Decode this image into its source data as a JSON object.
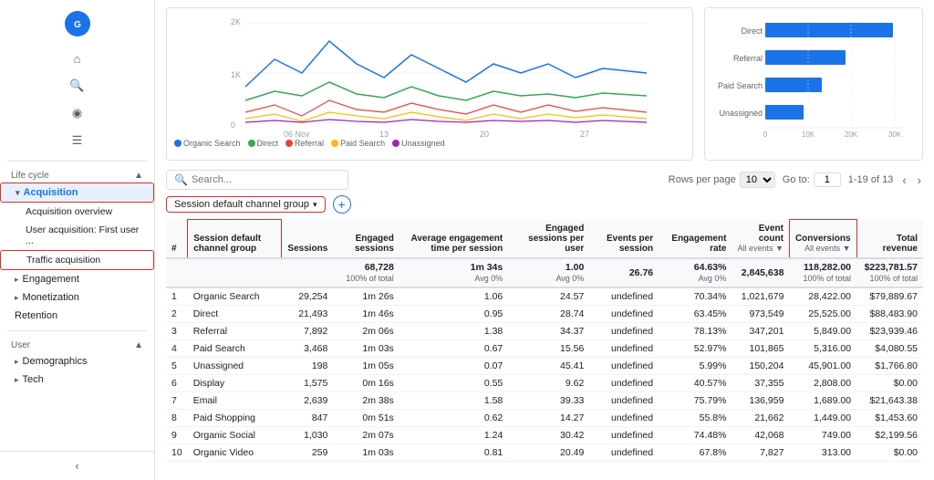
{
  "sidebar": {
    "logo": "G",
    "sections": [
      {
        "label": "Life cycle",
        "chevron": "▲",
        "items": [
          {
            "label": "Acquisition",
            "level": 1,
            "active": true,
            "highlight": true,
            "expandable": true
          },
          {
            "label": "Acquisition overview",
            "level": 2
          },
          {
            "label": "User acquisition: First user ...",
            "level": 2
          },
          {
            "label": "Traffic acquisition",
            "level": 2,
            "highlight": true
          },
          {
            "label": "Engagement",
            "level": 1,
            "expandable": true
          },
          {
            "label": "Monetization",
            "level": 1,
            "expandable": true
          },
          {
            "label": "Retention",
            "level": 1
          }
        ]
      },
      {
        "label": "User",
        "chevron": "▲",
        "items": [
          {
            "label": "Demographics",
            "level": 1,
            "expandable": true
          },
          {
            "label": "Tech",
            "level": 1,
            "expandable": true
          }
        ]
      }
    ]
  },
  "toolbar": {
    "search_placeholder": "Search...",
    "rows_per_page_label": "Rows per page",
    "rows_per_page_value": "10",
    "goto_label": "Go to:",
    "goto_value": "1",
    "pagination": "1-19 of 13",
    "filter_chip": "Session default channel group",
    "add_filter_icon": "+"
  },
  "chart": {
    "line": {
      "x_labels": [
        "06 Nov",
        "13",
        "20",
        "27"
      ],
      "y_labels": [
        "2K",
        "1K",
        "0"
      ],
      "legend": [
        {
          "label": "Organic Search",
          "color": "#1a73e8"
        },
        {
          "label": "Direct",
          "color": "#34a853"
        },
        {
          "label": "Referral",
          "color": "#ea4335"
        },
        {
          "label": "Paid Search",
          "color": "#fbbc04"
        },
        {
          "label": "Unassigned",
          "color": "#9c27b0"
        }
      ]
    },
    "bar": {
      "y_labels": [
        "Direct",
        "Referral",
        "Paid Search",
        "Unassigned"
      ],
      "x_labels": [
        "0",
        "10K",
        "20K",
        "30K"
      ],
      "bars": [
        {
          "label": "Direct",
          "value": 100,
          "color": "#1a73e8"
        },
        {
          "label": "Referral",
          "value": 62,
          "color": "#1a73e8"
        },
        {
          "label": "Paid Search",
          "value": 45,
          "color": "#1a73e8"
        },
        {
          "label": "Unassigned",
          "value": 30,
          "color": "#1a73e8"
        }
      ]
    }
  },
  "table": {
    "columns": [
      {
        "key": "num",
        "label": "#",
        "sub": "",
        "align": "left"
      },
      {
        "key": "channel",
        "label": "Session default channel group",
        "sub": "",
        "align": "left",
        "highlight": true
      },
      {
        "key": "sessions",
        "label": "Sessions",
        "sub": "",
        "align": "right"
      },
      {
        "key": "engaged",
        "label": "Engaged sessions",
        "sub": "",
        "align": "right"
      },
      {
        "key": "avg_engagement",
        "label": "Average engagement time per session",
        "sub": "",
        "align": "right"
      },
      {
        "key": "engaged_per_user",
        "label": "Engaged sessions per user",
        "sub": "",
        "align": "right"
      },
      {
        "key": "events_per_session",
        "label": "Events per session",
        "sub": "",
        "align": "right"
      },
      {
        "key": "engagement_rate",
        "label": "Engagement rate",
        "sub": "",
        "align": "right"
      },
      {
        "key": "event_count",
        "label": "Event count",
        "sub": "All events ▼",
        "align": "right"
      },
      {
        "key": "conversions",
        "label": "Conversions",
        "sub": "All events ▼",
        "align": "right",
        "highlight": true
      },
      {
        "key": "revenue",
        "label": "Total revenue",
        "sub": "",
        "align": "right"
      }
    ],
    "total_row": {
      "num": "",
      "channel": "",
      "sessions": "",
      "engaged": "68,728",
      "avg_engagement": "1m 34s",
      "engaged_per_user": "1.00",
      "events_per_session": "26.76",
      "engagement_rate": "64.63%",
      "event_count": "2,845,638",
      "conversions": "118,282.00",
      "revenue": "$223,781.57",
      "sub": "100% of total"
    },
    "rows": [
      {
        "num": "1",
        "channel": "Organic Search",
        "sessions": "29,254",
        "engaged": "1m 26s",
        "avg_engagement": "1.06",
        "engaged_per_user": "24.57",
        "engagement_rate": "70.34%",
        "event_count": "1,021,679",
        "conversions": "28,422.00",
        "revenue": "$79,889.67"
      },
      {
        "num": "2",
        "channel": "Direct",
        "sessions": "21,493",
        "engaged": "1m 46s",
        "avg_engagement": "0.95",
        "engaged_per_user": "28.74",
        "engagement_rate": "63.45%",
        "event_count": "973,549",
        "conversions": "25,525.00",
        "revenue": "$88,483.90"
      },
      {
        "num": "3",
        "channel": "Referral",
        "sessions": "7,892",
        "engaged": "2m 06s",
        "avg_engagement": "1.38",
        "engaged_per_user": "34.37",
        "engagement_rate": "78.13%",
        "event_count": "347,201",
        "conversions": "5,849.00",
        "revenue": "$23,939.46"
      },
      {
        "num": "4",
        "channel": "Paid Search",
        "sessions": "3,468",
        "engaged": "1m 03s",
        "avg_engagement": "0.67",
        "engaged_per_user": "15.56",
        "engagement_rate": "52.97%",
        "event_count": "101,865",
        "conversions": "5,316.00",
        "revenue": "$4,080.55"
      },
      {
        "num": "5",
        "channel": "Unassigned",
        "sessions": "198",
        "engaged": "1m 05s",
        "avg_engagement": "0.07",
        "engaged_per_user": "45.41",
        "engagement_rate": "5.99%",
        "event_count": "150,204",
        "conversions": "45,901.00",
        "revenue": "$1,766.80"
      },
      {
        "num": "6",
        "channel": "Display",
        "sessions": "1,575",
        "engaged": "0m 16s",
        "avg_engagement": "0.55",
        "engaged_per_user": "9.62",
        "engagement_rate": "40.57%",
        "event_count": "37,355",
        "conversions": "2,808.00",
        "revenue": "$0.00"
      },
      {
        "num": "7",
        "channel": "Email",
        "sessions": "2,639",
        "engaged": "2m 38s",
        "avg_engagement": "1.58",
        "engaged_per_user": "39.33",
        "engagement_rate": "75.79%",
        "event_count": "136,959",
        "conversions": "1,689.00",
        "revenue": "$21,643.38"
      },
      {
        "num": "8",
        "channel": "Paid Shopping",
        "sessions": "847",
        "engaged": "0m 51s",
        "avg_engagement": "0.62",
        "engaged_per_user": "14.27",
        "engagement_rate": "55.8%",
        "event_count": "21,662",
        "conversions": "1,449.00",
        "revenue": "$1,453.60"
      },
      {
        "num": "9",
        "channel": "Organic Social",
        "sessions": "1,030",
        "engaged": "2m 07s",
        "avg_engagement": "1.24",
        "engaged_per_user": "30.42",
        "engagement_rate": "74.48%",
        "event_count": "42,068",
        "conversions": "749.00",
        "revenue": "$2,199.56"
      },
      {
        "num": "10",
        "channel": "Organic Video",
        "sessions": "259",
        "engaged": "1m 03s",
        "avg_engagement": "0.81",
        "engaged_per_user": "20.49",
        "engagement_rate": "67.8%",
        "event_count": "7,827",
        "conversions": "313.00",
        "revenue": "$0.00"
      }
    ]
  }
}
